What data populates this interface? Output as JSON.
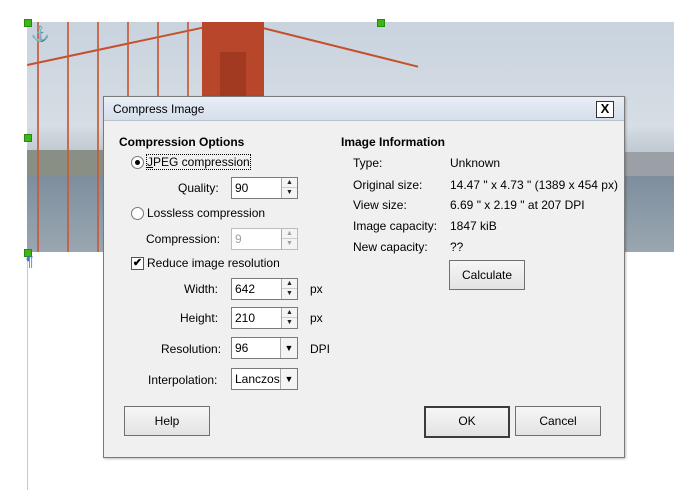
{
  "dialog": {
    "title": "Compress Image",
    "close_label": "X"
  },
  "compression": {
    "heading": "Compression Options",
    "jpeg_label": "JPEG compression",
    "quality_label": "Quality:",
    "quality_value": "90",
    "lossless_label": "Lossless compression",
    "compression_label": "Compression:",
    "compression_value": "9",
    "reduce_label": "Reduce image resolution",
    "width_label": "Width:",
    "width_value": "642",
    "width_unit": "px",
    "height_label": "Height:",
    "height_value": "210",
    "height_unit": "px",
    "resolution_label": "Resolution:",
    "resolution_value": "96",
    "resolution_unit": "DPI",
    "interpolation_label": "Interpolation:",
    "interpolation_value": "Lanczos"
  },
  "info": {
    "heading": "Image Information",
    "type_label": "Type:",
    "type_value": "Unknown",
    "original_label": "Original size:",
    "original_value": "14.47 \" x 4.73 \" (1389 x 454 px)",
    "view_label": "View size:",
    "view_value": "6.69 \" x 2.19 \" at 207 DPI",
    "capacity_label": "Image capacity:",
    "capacity_value": "1847 kiB",
    "new_capacity_label": "New capacity:",
    "new_capacity_value": "??",
    "calculate_label": "Calculate"
  },
  "buttons": {
    "help": "Help",
    "ok": "OK",
    "cancel": "Cancel"
  },
  "document": {
    "anchor_icon": "⚓",
    "pilcrow_icon": "¶"
  }
}
